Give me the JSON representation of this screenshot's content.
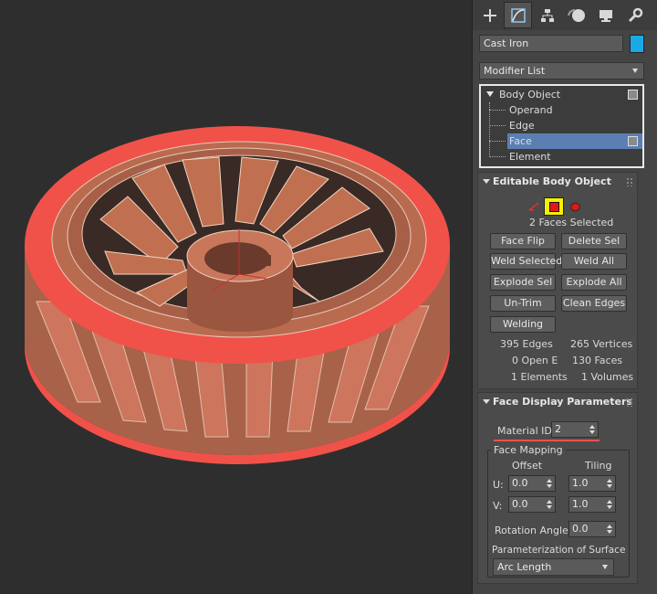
{
  "panel": {
    "tabs": [
      {
        "icon": "create-icon"
      },
      {
        "icon": "modify-icon",
        "active": true
      },
      {
        "icon": "hierarchy-icon"
      },
      {
        "icon": "motion-icon"
      },
      {
        "icon": "display-icon"
      },
      {
        "icon": "utilities-icon"
      }
    ],
    "object_name": "Cast Iron",
    "object_color": "#1aa9e6",
    "modifier_list": "Modifier List",
    "stack": {
      "root": "Body Object",
      "items": [
        "Operand",
        "Edge",
        "Face",
        "Element"
      ],
      "selected": "Face"
    }
  },
  "editable": {
    "title": "Editable Body Object",
    "selection_text": "2 Faces Selected",
    "buttons": {
      "face_flip": "Face Flip",
      "delete_sel": "Delete Sel",
      "weld_selected": "Weld Selected",
      "weld_all": "Weld All",
      "explode_sel": "Explode Sel",
      "explode_all": "Explode All",
      "un_trim": "Un-Trim",
      "clean_edges": "Clean Edges",
      "welding": "Welding"
    },
    "stats": {
      "edges": "395 Edges",
      "vertices": "265 Vertices",
      "open_e": "0 Open E",
      "faces": "130 Faces",
      "elements": "1 Elements",
      "volumes": "1 Volumes"
    }
  },
  "face_display": {
    "title": "Face Display Parameters",
    "material_id_label": "Material ID:",
    "material_id_value": "2",
    "face_mapping_title": "Face Mapping",
    "offset_label": "Offset",
    "tiling_label": "Tiling",
    "u_label": "U:",
    "v_label": "V:",
    "u_offset": "0.0",
    "u_tiling": "1.0",
    "v_offset": "0.0",
    "v_tiling": "1.0",
    "rotation_label": "Rotation Angle:",
    "rotation_value": "0.0",
    "param_label": "Parameterization of Surface",
    "param_value": "Arc Length"
  },
  "colors": {
    "selected_face": "#f0524a",
    "body": "#b0664a",
    "highlight": "#f5f000"
  }
}
